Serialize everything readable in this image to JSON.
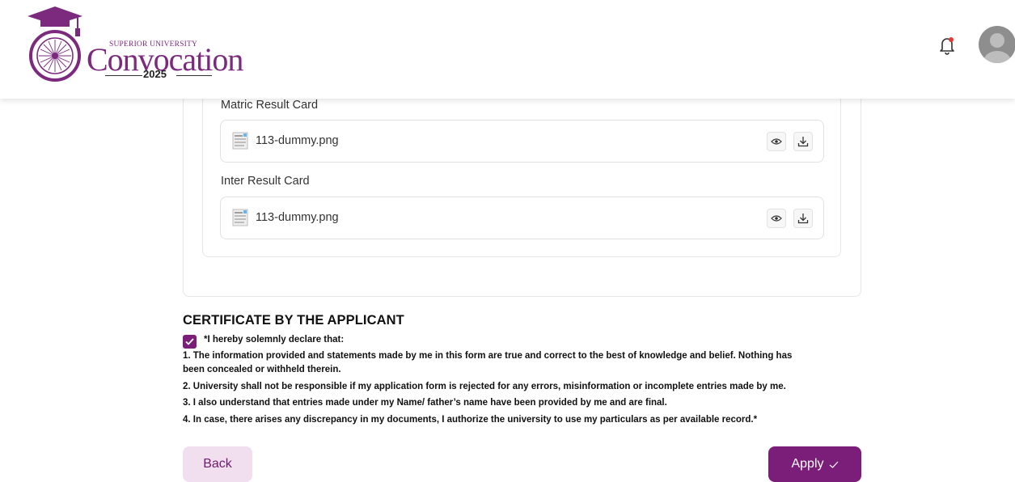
{
  "header": {
    "logo": {
      "small_text": "SUPERIOR UNIVERSITY",
      "big_text": "Convocation",
      "year": "2025"
    },
    "notification_icon": "bell-icon",
    "avatar_icon": "user-avatar"
  },
  "documents": [
    {
      "label": "Matric Result Card",
      "file_name": "113-dummy.png"
    },
    {
      "label": "Inter Result Card",
      "file_name": "113-dummy.png"
    }
  ],
  "certificate": {
    "title": "CERTIFICATE BY THE APPLICANT",
    "checked": true,
    "intro": "*I hereby solemnly declare that:",
    "lines": [
      "1. The information provided and statements made by me in this form are true and correct to the best of knowledge and belief. Nothing has",
      "been concealed or withheld therein.",
      "2. University shall not be responsible if my application form is rejected for any errors, misinformation or incomplete entries made by me.",
      "3. I also understand that entries made under my Name/ father’s name have been provided by me and are final.",
      "4. In case, there arises any discrepancy in my documents, I authorize the university to use my particulars as per available record.*"
    ]
  },
  "actions": {
    "back_label": "Back",
    "apply_label": "Apply"
  },
  "colors": {
    "brand": "#7b1e7a",
    "brand_light": "#f1dff0",
    "notification_dot": "#e53935"
  }
}
